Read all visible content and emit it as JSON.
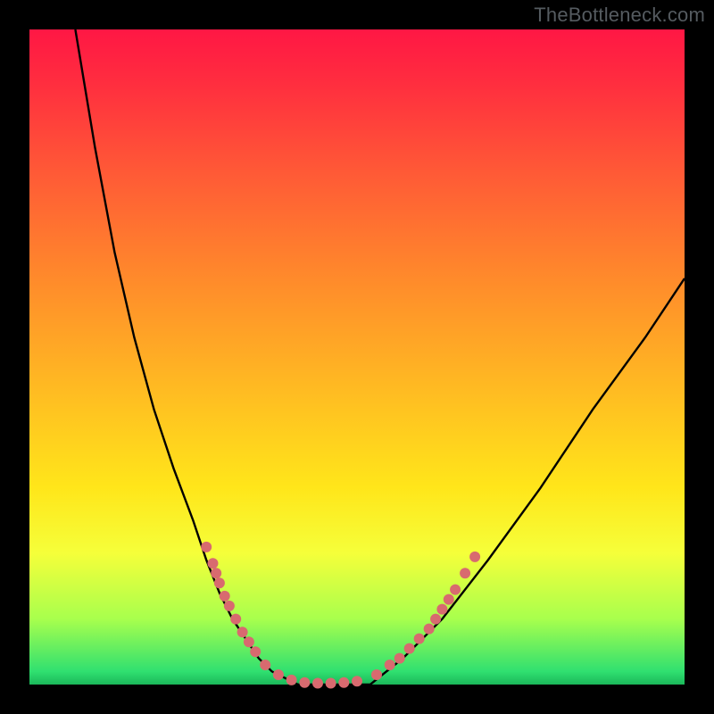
{
  "watermark": "TheBottleneck.com",
  "chart_data": {
    "type": "line",
    "title": "",
    "xlabel": "",
    "ylabel": "",
    "xlim": [
      0,
      100
    ],
    "ylim": [
      0,
      100
    ],
    "series": [
      {
        "name": "curve",
        "x": [
          7,
          10,
          13,
          16,
          19,
          22,
          25,
          27,
          29,
          31,
          33,
          35,
          37,
          39,
          41,
          52,
          57,
          63,
          70,
          78,
          86,
          94,
          100
        ],
        "y": [
          100,
          82,
          66,
          53,
          42,
          33,
          25,
          19,
          14,
          10,
          7,
          4,
          2,
          1,
          0,
          0,
          4,
          10,
          19,
          30,
          42,
          53,
          62
        ]
      }
    ],
    "markers": [
      {
        "x": 27.0,
        "y": 21.0
      },
      {
        "x": 28.0,
        "y": 18.5
      },
      {
        "x": 28.5,
        "y": 17.0
      },
      {
        "x": 29.0,
        "y": 15.5
      },
      {
        "x": 29.8,
        "y": 13.5
      },
      {
        "x": 30.5,
        "y": 12.0
      },
      {
        "x": 31.5,
        "y": 10.0
      },
      {
        "x": 32.5,
        "y": 8.0
      },
      {
        "x": 33.5,
        "y": 6.5
      },
      {
        "x": 34.5,
        "y": 5.0
      },
      {
        "x": 36.0,
        "y": 3.0
      },
      {
        "x": 38.0,
        "y": 1.5
      },
      {
        "x": 40.0,
        "y": 0.7
      },
      {
        "x": 42.0,
        "y": 0.3
      },
      {
        "x": 44.0,
        "y": 0.2
      },
      {
        "x": 46.0,
        "y": 0.2
      },
      {
        "x": 48.0,
        "y": 0.3
      },
      {
        "x": 50.0,
        "y": 0.5
      },
      {
        "x": 53.0,
        "y": 1.5
      },
      {
        "x": 55.0,
        "y": 3.0
      },
      {
        "x": 56.5,
        "y": 4.0
      },
      {
        "x": 58.0,
        "y": 5.5
      },
      {
        "x": 59.5,
        "y": 7.0
      },
      {
        "x": 61.0,
        "y": 8.5
      },
      {
        "x": 62.0,
        "y": 10.0
      },
      {
        "x": 63.0,
        "y": 11.5
      },
      {
        "x": 64.0,
        "y": 13.0
      },
      {
        "x": 65.0,
        "y": 14.5
      },
      {
        "x": 66.5,
        "y": 17.0
      },
      {
        "x": 68.0,
        "y": 19.5
      }
    ],
    "marker_color": "#d86a6f",
    "curve_color": "#000000",
    "gradient_stops": [
      {
        "pos": 0,
        "color": "#ff1744"
      },
      {
        "pos": 0.7,
        "color": "#ffe61a"
      },
      {
        "pos": 0.9,
        "color": "#a8ff4d"
      },
      {
        "pos": 1,
        "color": "#1bb85a"
      }
    ]
  }
}
